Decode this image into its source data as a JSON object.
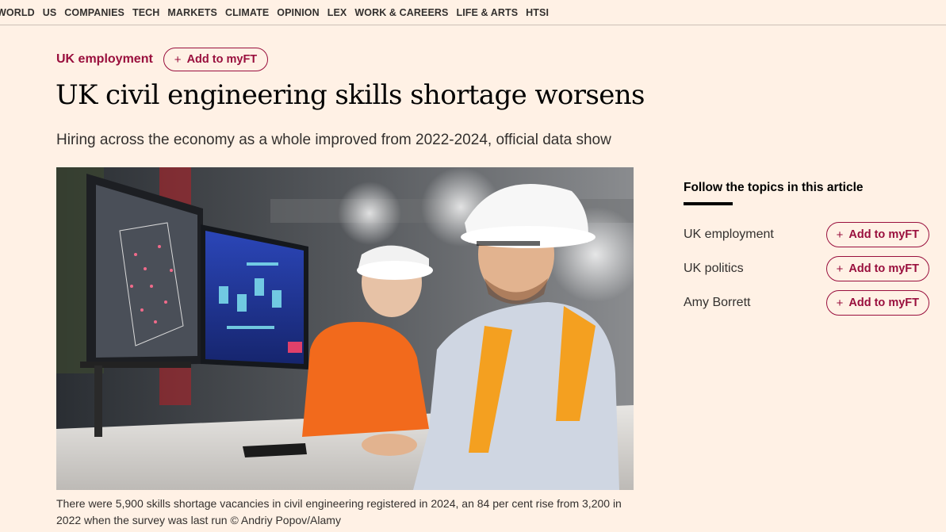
{
  "nav": [
    "WORLD",
    "US",
    "COMPANIES",
    "TECH",
    "MARKETS",
    "CLIMATE",
    "OPINION",
    "LEX",
    "WORK & CAREERS",
    "LIFE & ARTS",
    "HTSI"
  ],
  "topic": {
    "label": "UK employment",
    "add_label": "Add to myFT"
  },
  "article": {
    "headline": "UK civil engineering skills shortage worsens",
    "standfirst": "Hiring across the economy as a whole improved from 2022-2024, official data show",
    "caption": "There were 5,900 skills shortage vacancies in civil engineering registered in 2024, an 84 per cent rise from 3,200 in 2022 when the survey was last run © Andriy Popov/Alamy"
  },
  "follow": {
    "title": "Follow the topics in this article",
    "items": [
      {
        "name": "UK employment",
        "add_label": "Add to myFT"
      },
      {
        "name": "UK politics",
        "add_label": "Add to myFT"
      },
      {
        "name": "Amy Borrett",
        "add_label": "Add to myFT"
      }
    ]
  },
  "colors": {
    "page_bg": "#fff1e5",
    "accent": "#990f3d"
  }
}
